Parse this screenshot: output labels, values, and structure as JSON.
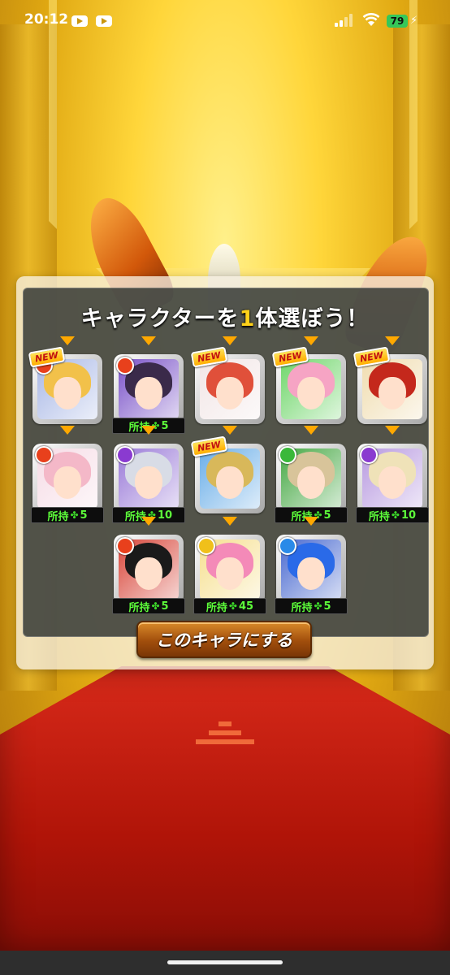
{
  "status_bar": {
    "time": "20:12",
    "battery": "79",
    "notification_icons": [
      "youtube-icon",
      "youtube-icon"
    ]
  },
  "dialog": {
    "title_prefix": "キャラクターを",
    "title_number": "1",
    "title_suffix": "体選ぼう！",
    "confirm_label": "このキャラにする",
    "new_badge": "NEW",
    "owned_label": "所持",
    "clover_glyph": "✤",
    "characters": [
      {
        "row": 1,
        "slot": 1,
        "new": true,
        "owned": "",
        "element": "fire",
        "hair": "#f2c14a",
        "bg": "#a9b8e6"
      },
      {
        "row": 1,
        "slot": 2,
        "new": false,
        "owned": "5",
        "element": "fire",
        "hair": "#3a2a4a",
        "bg": "#7a52c8"
      },
      {
        "row": 1,
        "slot": 3,
        "new": true,
        "owned": "",
        "element": "none",
        "hair": "#e0503a",
        "bg": "#f2e6e6"
      },
      {
        "row": 1,
        "slot": 4,
        "new": true,
        "owned": "",
        "element": "none",
        "hair": "#f6a4c4",
        "bg": "#6fd66a"
      },
      {
        "row": 1,
        "slot": 5,
        "new": true,
        "owned": "",
        "element": "none",
        "hair": "#c4281c",
        "bg": "#f0ddb0"
      },
      {
        "row": 2,
        "slot": 1,
        "new": false,
        "owned": "5",
        "element": "fire",
        "hair": "#f4b8c8",
        "bg": "#f6dce6"
      },
      {
        "row": 2,
        "slot": 2,
        "new": false,
        "owned": "10",
        "element": "dark",
        "hair": "#d8dce6",
        "bg": "#9a7ad8"
      },
      {
        "row": 2,
        "slot": 3,
        "new": true,
        "owned": "",
        "element": "none",
        "hair": "#d8b85a",
        "bg": "#6aaee8"
      },
      {
        "row": 2,
        "slot": 4,
        "new": false,
        "owned": "5",
        "element": "wood",
        "hair": "#d8c49a",
        "bg": "#46a844"
      },
      {
        "row": 2,
        "slot": 5,
        "new": false,
        "owned": "10",
        "element": "dark",
        "hair": "#efe2b8",
        "bg": "#b89ae0"
      },
      {
        "row": 3,
        "slot": 1,
        "new": false,
        "owned": "5",
        "element": "fire",
        "hair": "#1a1a1a",
        "bg": "#d8463a"
      },
      {
        "row": 3,
        "slot": 2,
        "new": false,
        "owned": "45",
        "element": "light",
        "hair": "#f48ab8",
        "bg": "#f6e090"
      },
      {
        "row": 3,
        "slot": 3,
        "new": false,
        "owned": "5",
        "element": "water",
        "hair": "#2a6ae8",
        "bg": "#4a6ad0"
      }
    ]
  },
  "element_colors": {
    "fire": "#e8401c",
    "water": "#2a8ae8",
    "wood": "#3ab83a",
    "light": "#f0c01a",
    "dark": "#8a3ad0"
  },
  "accent_colors": {
    "title_number": "#ffd21a",
    "owned_text": "#5dff3a",
    "arrow": "#ffa800",
    "button": "#a14e0c"
  }
}
